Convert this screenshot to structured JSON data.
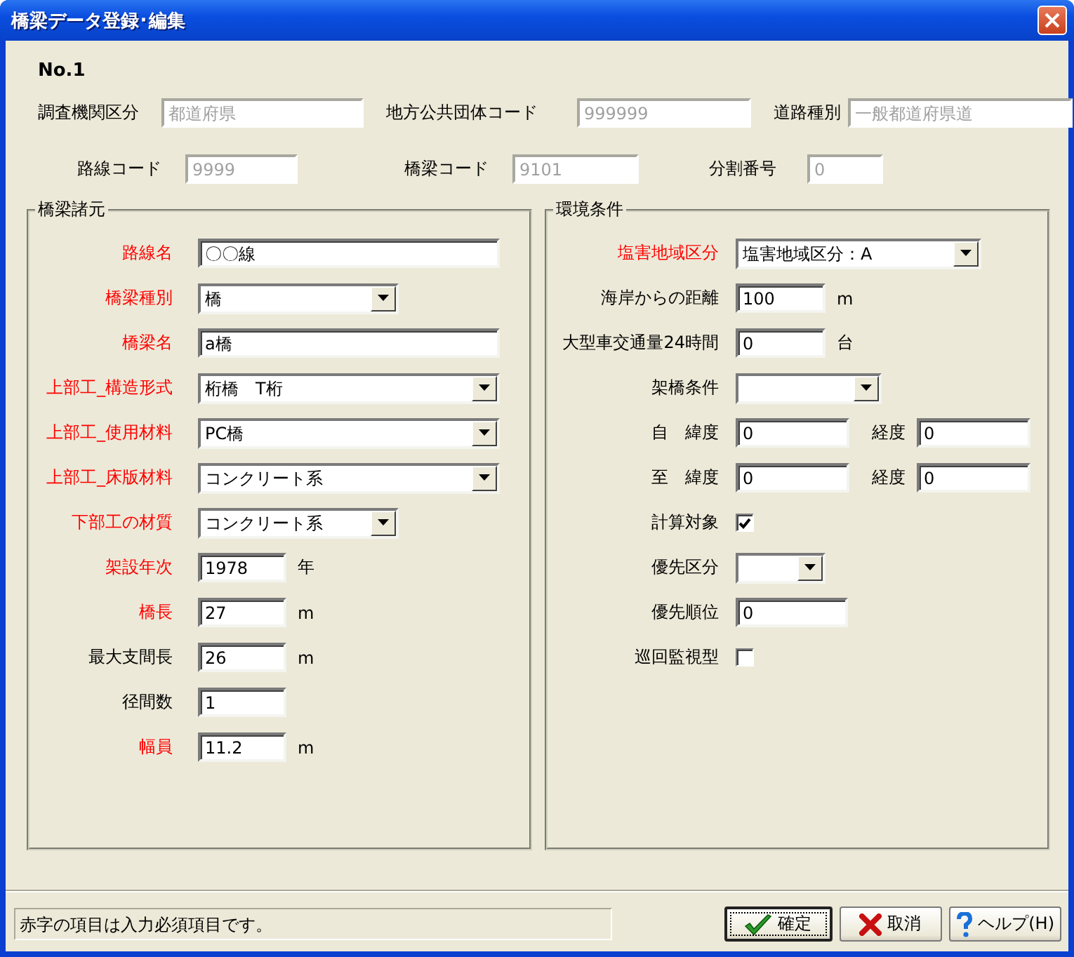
{
  "window": {
    "title": "橋梁データ登録･編集"
  },
  "record_no": "No.1",
  "header_rows": [
    [
      {
        "label": "調査機関区分",
        "value": "都道府県",
        "disabled": true
      },
      {
        "label": "地方公共団体コード",
        "value": "999999",
        "disabled": true
      },
      {
        "label": "道路種別",
        "value": "一般都道府県道",
        "disabled": true
      }
    ],
    [
      {
        "label": "路線コード",
        "value": "9999",
        "disabled": true
      },
      {
        "label": "橋梁コード",
        "value": "9101",
        "disabled": true
      },
      {
        "label": "分割番号",
        "value": "0",
        "disabled": true
      }
    ]
  ],
  "bridge_group": {
    "title": "橋梁諸元",
    "fields": [
      {
        "kind": "text",
        "label": "路線名",
        "required": true,
        "value": "〇〇線"
      },
      {
        "kind": "select",
        "label": "橋梁種別",
        "required": true,
        "value": "橋"
      },
      {
        "kind": "text",
        "label": "橋梁名",
        "required": true,
        "value": "a橋"
      },
      {
        "kind": "select",
        "label": "上部工_構造形式",
        "required": true,
        "value": "桁橋　T桁"
      },
      {
        "kind": "select",
        "label": "上部工_使用材料",
        "required": true,
        "value": "PC橋"
      },
      {
        "kind": "select",
        "label": "上部工_床版材料",
        "required": true,
        "value": "コンクリート系"
      },
      {
        "kind": "select",
        "label": "下部工の材質",
        "required": true,
        "value": "コンクリート系"
      },
      {
        "kind": "text",
        "label": "架設年次",
        "required": true,
        "value": "1978",
        "unit": "年"
      },
      {
        "kind": "text",
        "label": "橋長",
        "required": true,
        "value": "27",
        "unit": "m"
      },
      {
        "kind": "text",
        "label": "最大支間長",
        "required": false,
        "value": "26",
        "unit": "m"
      },
      {
        "kind": "text",
        "label": "径間数",
        "required": false,
        "value": "1"
      },
      {
        "kind": "text",
        "label": "幅員",
        "required": true,
        "value": "11.2",
        "unit": "m"
      }
    ]
  },
  "environment_group": {
    "title": "環境条件",
    "fields": [
      {
        "kind": "select",
        "label": "塩害地域区分",
        "required": true,
        "value": "塩害地域区分：A"
      },
      {
        "kind": "text",
        "label": "海岸からの距離",
        "required": false,
        "value": "100",
        "unit": "m"
      },
      {
        "kind": "text",
        "label": "大型車交通量24時間",
        "required": false,
        "value": "0",
        "unit": "台"
      },
      {
        "kind": "select",
        "label": "架橋条件",
        "required": false
      },
      {
        "kind": "coords",
        "label": "自　緯度",
        "required": false,
        "value": "0",
        "sub_label": "経度",
        "sub_value": "0"
      },
      {
        "kind": "coords",
        "label": "至　緯度",
        "required": false,
        "value": "0",
        "sub_label": "経度",
        "sub_value": "0"
      },
      {
        "kind": "checkbox",
        "label": "計算対象",
        "required": false,
        "checked": true
      },
      {
        "kind": "select",
        "label": "優先区分",
        "required": false
      },
      {
        "kind": "text",
        "label": "優先順位",
        "required": false,
        "value": "0"
      },
      {
        "kind": "checkbox",
        "label": "巡回監視型",
        "required": false,
        "checked": false
      }
    ]
  },
  "status_text": "赤字の項目は入力必須項目です。",
  "buttons": [
    {
      "kind": "ok",
      "label": "確定",
      "default": true
    },
    {
      "kind": "cancel",
      "label": "取消",
      "default": false
    },
    {
      "kind": "help",
      "label": "ヘルプ(H)",
      "default": false
    }
  ]
}
